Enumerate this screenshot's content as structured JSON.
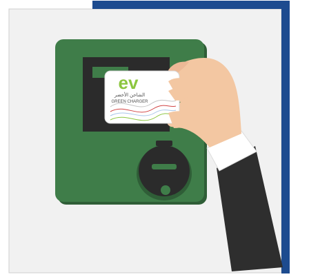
{
  "illustration": {
    "card": {
      "logo_text": "ev",
      "arabic_text": "الشاحن الأخضر",
      "brand_text": "GREEN CHARGER"
    },
    "colors": {
      "frame_border": "#1d4b8f",
      "panel_fill": "#f1f1f1",
      "charger_body": "#3f7d49",
      "charger_edge": "#2f5e37",
      "screen": "#2b2b2b",
      "screen_label": "#3f7d49",
      "card_bg": "#ffffff",
      "logo_green": "#8cc63f",
      "sleeve": "#2e2e2e",
      "skin": "#f3c7a2"
    },
    "icons": {
      "frame": "blue-corner-frame",
      "device": "ev-charger-terminal",
      "hand": "hand-with-card"
    }
  }
}
